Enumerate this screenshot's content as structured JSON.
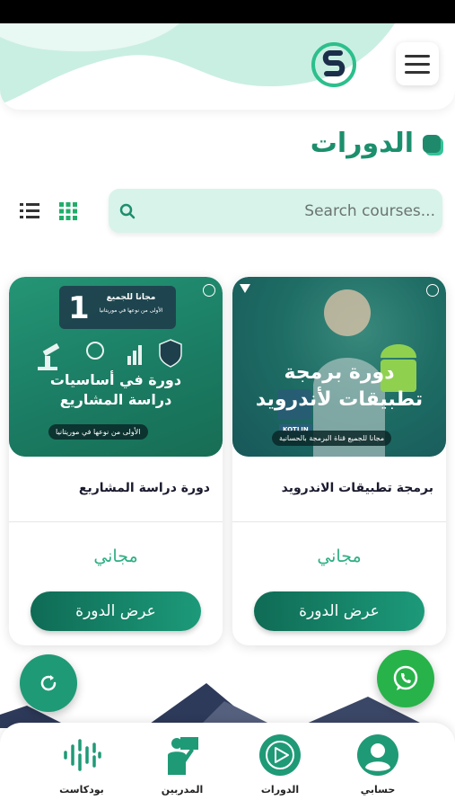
{
  "header": {
    "menu_icon": "hamburger-menu-icon",
    "logo_icon": "brand-logo-icon"
  },
  "page": {
    "title": "الدورات"
  },
  "search": {
    "placeholder": "Search courses..."
  },
  "view_toggle": {
    "list_icon": "list-view-icon",
    "grid_icon": "grid-view-icon"
  },
  "courses": [
    {
      "name": "برمجة تطبيقات الاندرويد",
      "image_title": "دورة برمجة تطبيقات لأندرويد",
      "image_badge": "مجانا للجميع قناة البرمجة بالحسانية",
      "image_tag": "KOTLIN",
      "price": "مجاني",
      "button": "عرض الدورة"
    },
    {
      "name": "دورة دراسة المشاريع",
      "image_title": "دورة في أساسيات دراسة المشاريع",
      "image_top_label": "مجانا للجميع",
      "image_top_sub": "الأولى من نوعها في موريتانيا",
      "image_number": "1",
      "image_badge": "الأولى من نوعها في موريتانيا",
      "price": "مجاني",
      "button": "عرض الدورة"
    }
  ],
  "bottom_nav": [
    {
      "label": "حسابي",
      "icon": "account-icon"
    },
    {
      "label": "الدورات",
      "icon": "play-courses-icon"
    },
    {
      "label": "المدربين",
      "icon": "trainers-icon"
    },
    {
      "label": "بودكاست",
      "icon": "podcast-icon"
    }
  ],
  "colors": {
    "primary": "#1c8f6d",
    "accent": "#35c29a",
    "whatsapp": "#27b34a"
  }
}
